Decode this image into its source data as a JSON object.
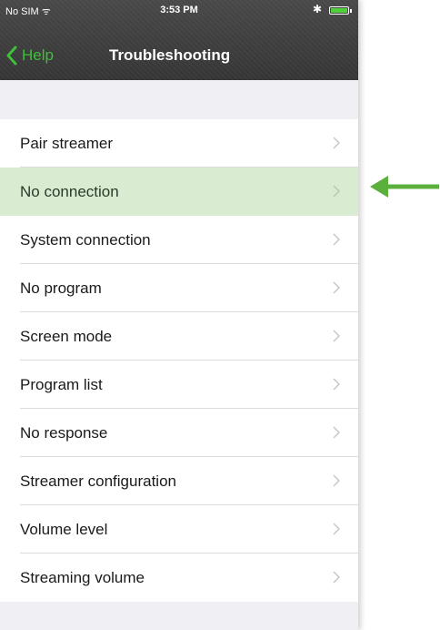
{
  "status_bar": {
    "carrier": "No SIM ᯤ",
    "time": "3:53 PM",
    "bluetooth": "✱"
  },
  "nav": {
    "back_label": "Help",
    "title": "Troubleshooting"
  },
  "items": [
    {
      "label": "Pair streamer"
    },
    {
      "label": "No connection",
      "highlighted": true
    },
    {
      "label": "System connection"
    },
    {
      "label": "No program"
    },
    {
      "label": "Screen mode"
    },
    {
      "label": "Program list"
    },
    {
      "label": "No response"
    },
    {
      "label": "Streamer configuration"
    },
    {
      "label": "Volume level"
    },
    {
      "label": "Streaming volume"
    }
  ],
  "colors": {
    "accent": "#3fbf3a",
    "highlight_row": "#d9ecd2",
    "arrow": "#5bb03c",
    "navbar": "#3d3d3d"
  },
  "icons": {
    "back": "chevron-left-icon",
    "row": "chevron-right-icon",
    "pointer": "arrow-left-icon"
  }
}
